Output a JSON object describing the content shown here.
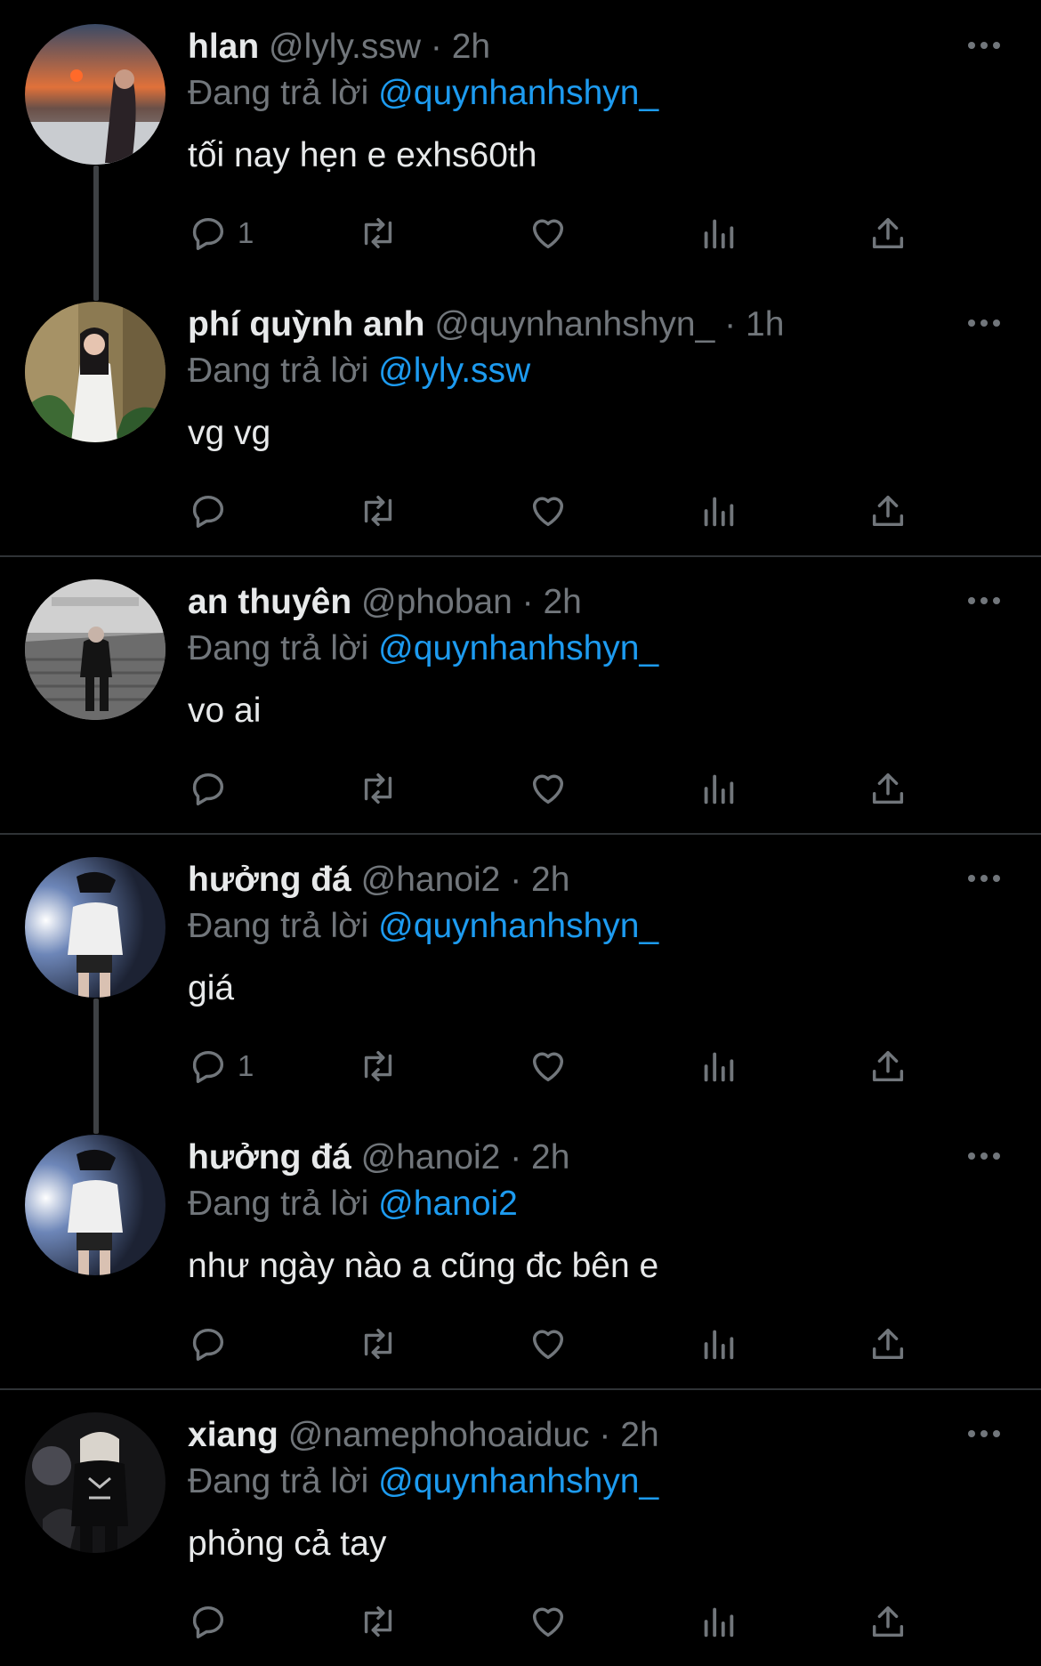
{
  "reply_prefix": "Đang trả lời",
  "icons": {
    "reply": "reply-icon",
    "retweet": "retweet-icon",
    "like": "heart-icon",
    "stats": "analytics-icon",
    "share": "share-icon",
    "more": "more-icon"
  },
  "colors": {
    "background": "#000000",
    "text": "#e7e9ea",
    "muted": "#71767b",
    "accent": "#1d9bf0"
  },
  "tweets": [
    {
      "name": "hlan",
      "handle": "@lyly.ssw",
      "dot": "·",
      "time": "2h",
      "reply_to": "@quynhanhshyn_",
      "text": "tối nay hẹn e exhs60th",
      "reply_count": "1"
    },
    {
      "name": "phí quỳnh anh",
      "handle": "@quynhanhshyn_",
      "dot": "·",
      "time": "1h",
      "reply_to": "@lyly.ssw",
      "text": "vg vg",
      "reply_count": ""
    },
    {
      "name": "an thuyên",
      "handle": "@phoban",
      "dot": "·",
      "time": "2h",
      "reply_to": "@quynhanhshyn_",
      "text": "vo ai",
      "reply_count": ""
    },
    {
      "name": "hưởng đá",
      "handle": "@hanoi2",
      "dot": "·",
      "time": "2h",
      "reply_to": "@quynhanhshyn_",
      "text": "giá",
      "reply_count": "1"
    },
    {
      "name": "hưởng đá",
      "handle": "@hanoi2",
      "dot": "·",
      "time": "2h",
      "reply_to": "@hanoi2",
      "text": "như ngày nào a cũng đc bên e",
      "reply_count": ""
    },
    {
      "name": "xiang",
      "handle": "@namephohoaiduc",
      "dot": "·",
      "time": "2h",
      "reply_to": "@quynhanhshyn_",
      "text": "phỏng cả tay",
      "reply_count": ""
    }
  ]
}
